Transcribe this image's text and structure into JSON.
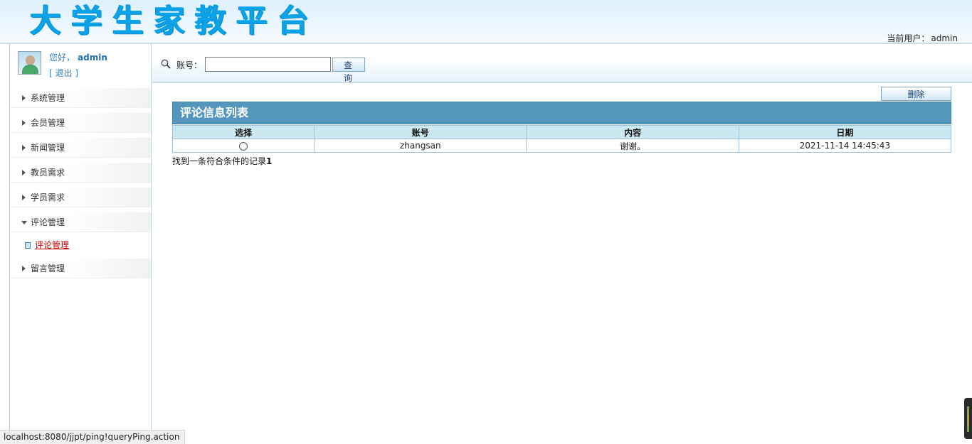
{
  "header": {
    "logo_text": "大学生家教平台",
    "current_user_label": "当前用户：",
    "current_user_name": "admin"
  },
  "sidebar": {
    "greeting": "您好，",
    "username": "admin",
    "logout": "[ 退出 ]",
    "items": [
      {
        "label": "系统管理",
        "expanded": false
      },
      {
        "label": "会员管理",
        "expanded": false
      },
      {
        "label": "新闻管理",
        "expanded": false
      },
      {
        "label": "教员需求",
        "expanded": false
      },
      {
        "label": "学员需求",
        "expanded": false
      },
      {
        "label": "评论管理",
        "expanded": true,
        "children": [
          {
            "label": "评论管理"
          }
        ]
      },
      {
        "label": "留言管理",
        "expanded": false
      }
    ]
  },
  "search": {
    "label": "账号：",
    "value": "",
    "placeholder": "",
    "query_button": "查 询"
  },
  "toolbar": {
    "delete_button": "删除"
  },
  "list": {
    "title": "评论信息列表",
    "columns": [
      "选择",
      "账号",
      "内容",
      "日期"
    ],
    "rows": [
      {
        "account": "zhangsan",
        "content": "谢谢。",
        "date": "2021-11-14 14:45:43",
        "selected": false
      }
    ],
    "record_text": "找到一条符合条件的记录",
    "record_count": "1"
  },
  "status_bar": {
    "url": "localhost:8080/jjpt/ping!queryPing.action"
  },
  "colors": {
    "logo": "#0aa3e8",
    "title_bar": "#5596bc",
    "table_header": "#cbe8f0",
    "active_link": "#cc0000"
  },
  "icons": [
    "search-icon",
    "avatar-icon",
    "chevron-right-icon",
    "chevron-down-icon",
    "submenu-square-icon",
    "radio-icon"
  ]
}
